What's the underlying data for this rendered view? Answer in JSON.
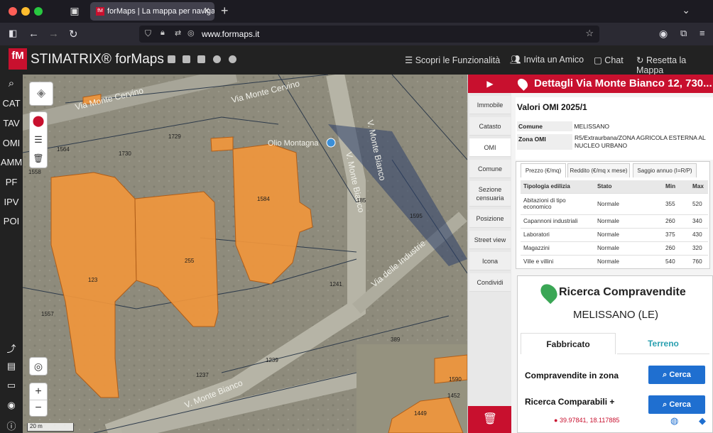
{
  "browser": {
    "tab_title": "forMaps | La mappa per navigar",
    "url": "www.formaps.it"
  },
  "header": {
    "logo": "fM",
    "brand": "STIMATRIX® forMaps",
    "menu": [
      "Scopri le Funzionalità",
      "Invita un Amico",
      "Chat",
      "Resetta la Mappa"
    ]
  },
  "left_toolbar": [
    "CAT",
    "TAV",
    "OMI",
    "AMM",
    "PF",
    "IPV",
    "POI"
  ],
  "map": {
    "scale": "20 m",
    "streets": [
      "Via Monte Cervino",
      "Via Monte Cervino",
      "V. Monte Bianco",
      "V. Monte Bianco",
      "V. Monte Bianco",
      "Via delle Industrie"
    ],
    "poi": "Olio Montagna",
    "parcels": [
      "123",
      "255",
      "1584",
      "1564",
      "1729",
      "1730",
      "1558",
      "1557",
      "1241",
      "1237",
      "1239",
      "389",
      "1590",
      "1449",
      "1452",
      "185",
      "1595"
    ]
  },
  "side_tabs": [
    "Immobile",
    "Catasto",
    "OMI",
    "Comune",
    "Sezione censuaria",
    "Posizione",
    "Street view",
    "Icona",
    "Condividi"
  ],
  "active_side_tab": "OMI",
  "panel": {
    "title": "Dettagli Via Monte Bianco 12, 730...",
    "omi_title": "Valori OMI 2025/1",
    "comune_label": "Comune",
    "comune_value": "MELISSANO",
    "zona_label": "Zona OMI",
    "zona_value": "R5/Extraurbana/ZONA AGRICOLA ESTERNA AL NUCLEO URBANO",
    "value_tabs": [
      "Prezzo (€/mq)",
      "Reddito (€/mq x mese)",
      "Saggio annuo (I=R/P)"
    ],
    "table_headers": [
      "Tipologia edilizia",
      "Stato",
      "Min",
      "Max"
    ],
    "table_rows": [
      [
        "Abitazioni di tipo economico",
        "Normale",
        "355",
        "520"
      ],
      [
        "Capannoni industriali",
        "Normale",
        "260",
        "340"
      ],
      [
        "Laboratori",
        "Normale",
        "375",
        "430"
      ],
      [
        "Magazzini",
        "Normale",
        "260",
        "320"
      ],
      [
        "Ville e villini",
        "Normale",
        "540",
        "760"
      ]
    ]
  },
  "compravendite": {
    "title": "Ricerca Compravendite",
    "location": "MELISSANO (LE)",
    "tab_fabbricato": "Fabbricato",
    "tab_terreno": "Terreno",
    "row1": "Compravendite in zona",
    "row2": "Ricerca Comparabili +",
    "button": "Cerca"
  },
  "coords": "39.97841, 18.117885",
  "colors": {
    "accent": "#c8102e",
    "parcel": "#f0963c",
    "button": "#1f6fd0",
    "terreno": "#2aa0b0"
  }
}
